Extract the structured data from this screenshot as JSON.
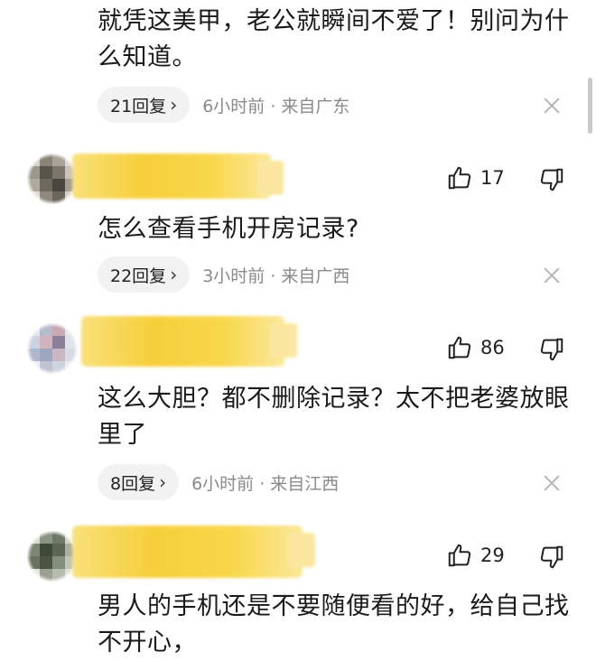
{
  "comments": [
    {
      "text": "就凭这美甲，老公就瞬间不爱了！别问为什么知道。",
      "reply_label": "21回复",
      "meta": "6小时前 · 来自广东"
    },
    {
      "likes": "17",
      "text": "怎么查看手机开房记录?",
      "reply_label": "22回复",
      "meta": "3小时前 · 来自广西"
    },
    {
      "likes": "86",
      "text": "这么大胆？都不删除记录？太不把老婆放眼里了",
      "reply_label": "8回复",
      "meta": "6小时前 · 来自江西"
    },
    {
      "likes": "29",
      "text": "男人的手机还是不要随便看的好，给自己找不开心，"
    }
  ],
  "icons": {
    "like": "thumbs-up-icon",
    "dislike": "thumbs-down-icon",
    "close": "close-icon",
    "reply_chevron": "chevron-right-icon"
  },
  "colors": {
    "censor_yellow": "#f6cf3a",
    "meta_gray": "#8a8a8a",
    "pill_bg": "#f2f2f2"
  }
}
